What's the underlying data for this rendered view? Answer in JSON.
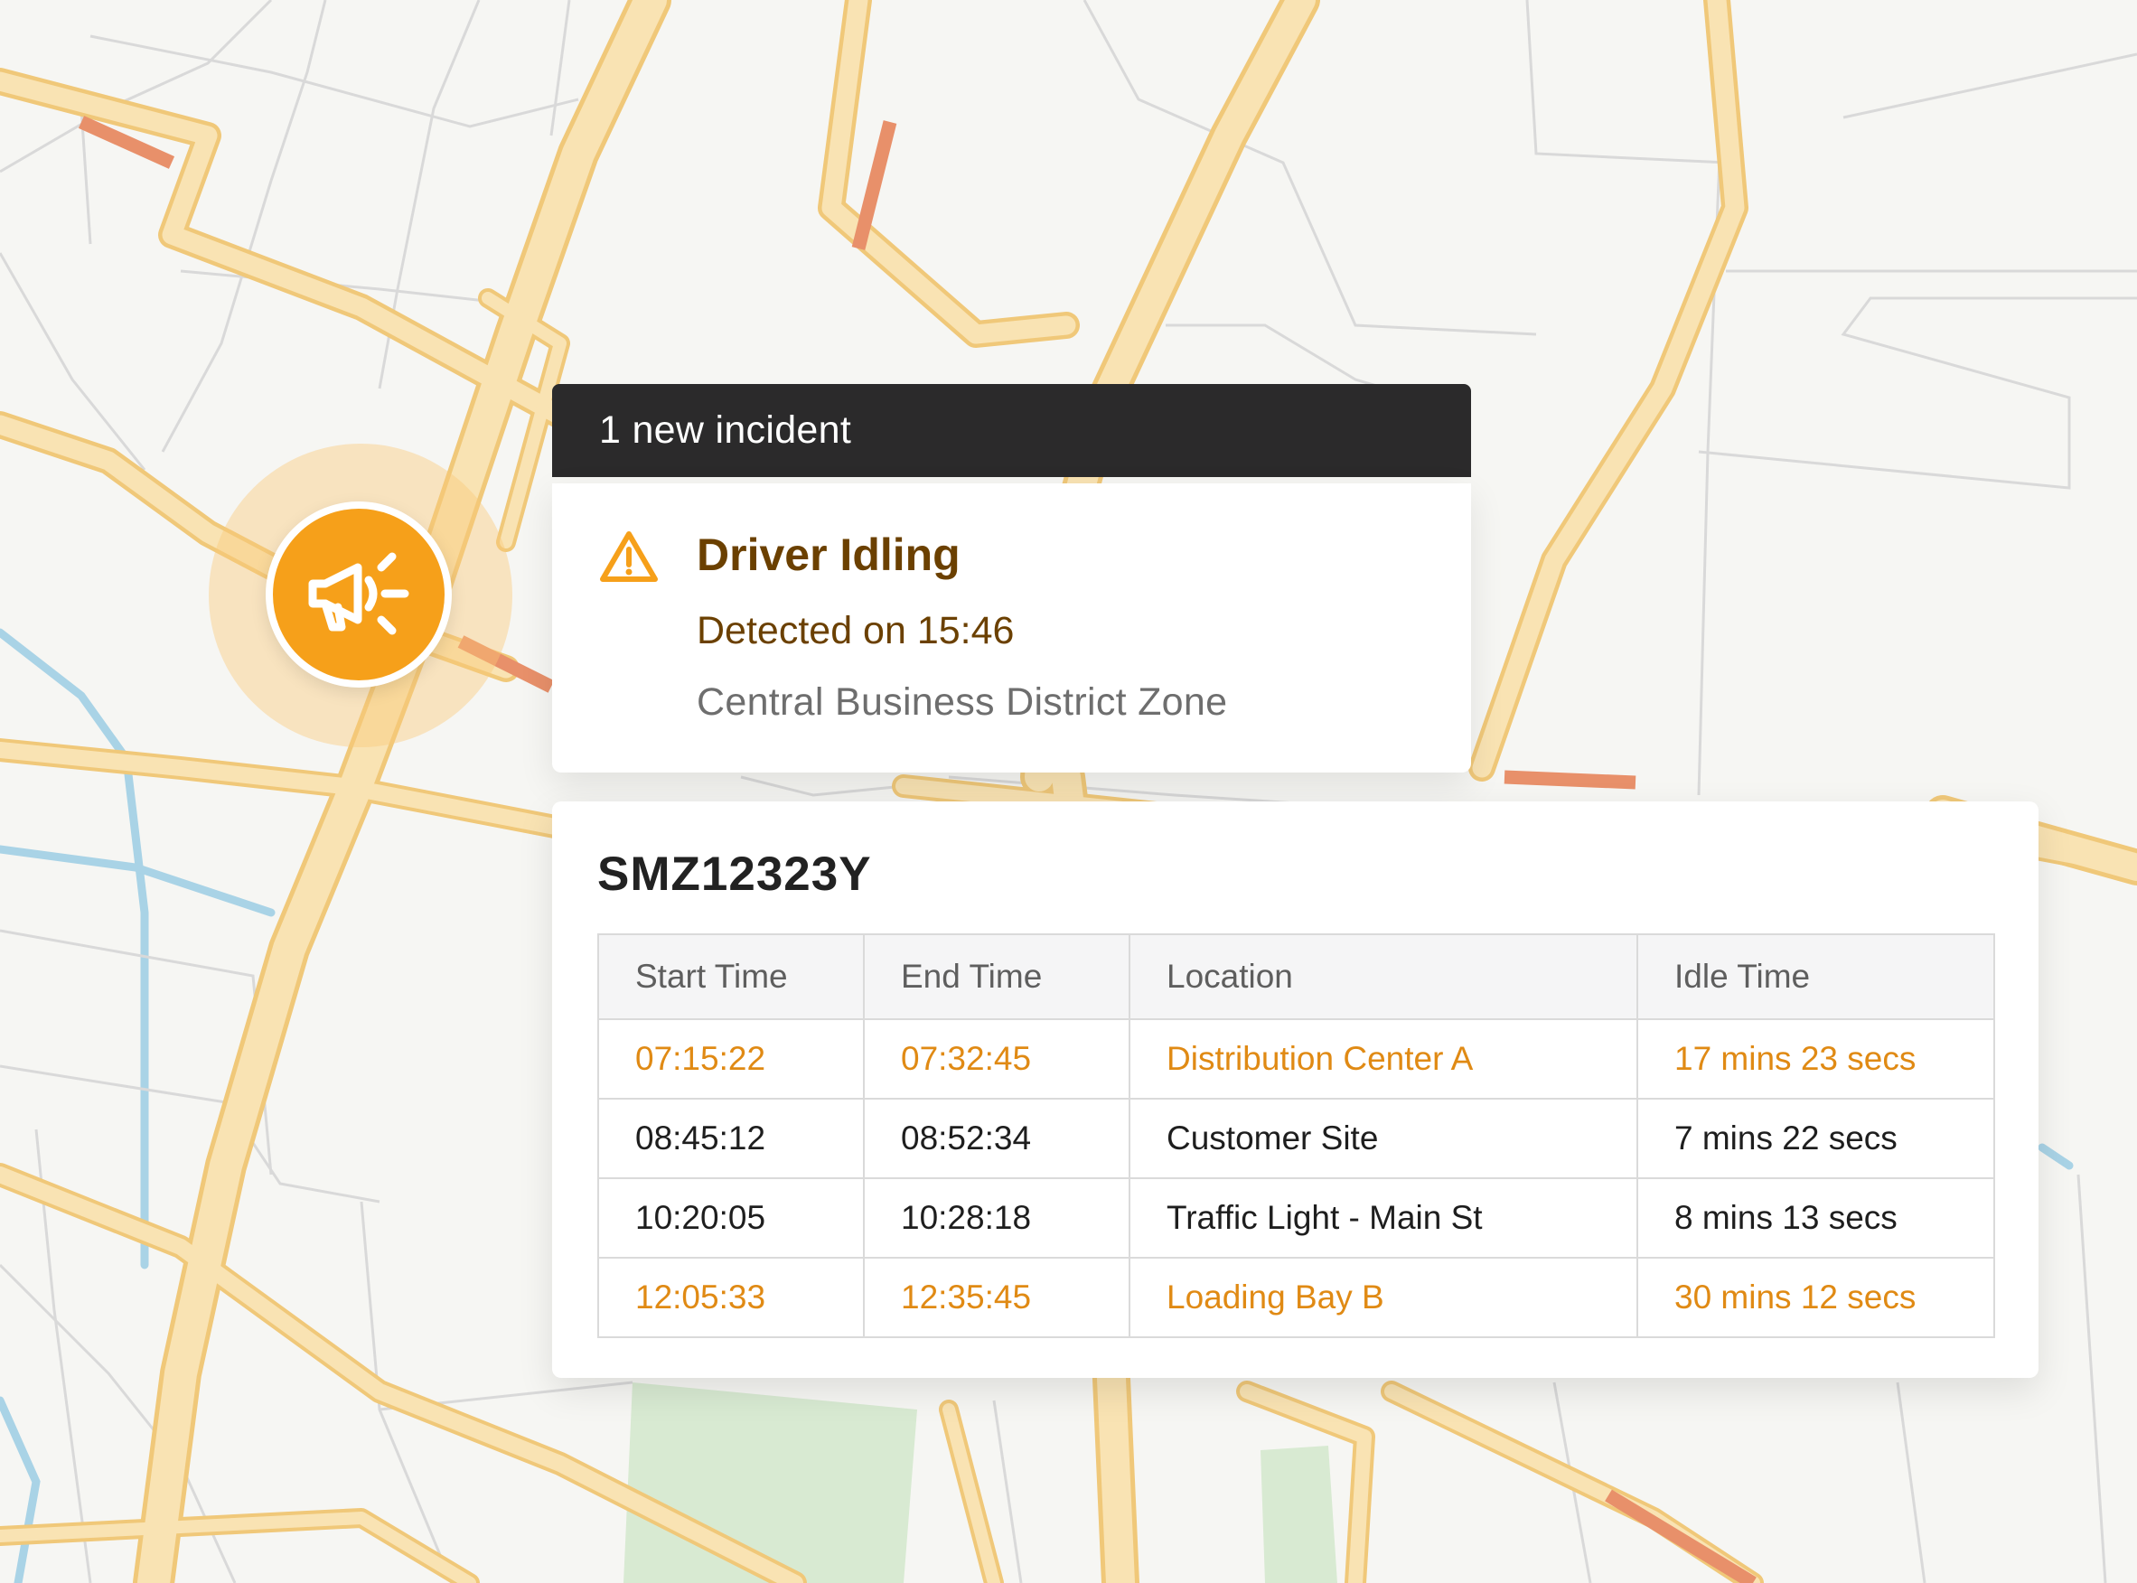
{
  "colors": {
    "accent": "#f6a01a",
    "highlight_text": "#e08a14",
    "incident_title": "#6b4000",
    "header_bar": "#2b2a2b",
    "map_major_road": "#f5d487",
    "map_water": "#a9d3e6",
    "map_park": "#d8ead2"
  },
  "marker": {
    "icon": "megaphone-icon"
  },
  "notification": {
    "header": "1 new incident"
  },
  "incident": {
    "icon": "warning-triangle-icon",
    "title": "Driver Idling",
    "detected": "Detected on 15:46",
    "zone": "Central Business District Zone"
  },
  "vehicle": {
    "id": "SMZ12323Y",
    "columns": [
      "Start Time",
      "End Time",
      "Location",
      "Idle Time"
    ],
    "rows": [
      {
        "start": "07:15:22",
        "end": "07:32:45",
        "location": "Distribution Center A",
        "idle": "17 mins 23 secs",
        "highlighted": true
      },
      {
        "start": "08:45:12",
        "end": "08:52:34",
        "location": "Customer Site",
        "idle": "7 mins 22 secs",
        "highlighted": false
      },
      {
        "start": "10:20:05",
        "end": "10:28:18",
        "location": "Traffic Light - Main St",
        "idle": "8 mins 13 secs",
        "highlighted": false
      },
      {
        "start": "12:05:33",
        "end": "12:35:45",
        "location": "Loading Bay B",
        "idle": "30 mins 12 secs",
        "highlighted": true
      }
    ]
  }
}
